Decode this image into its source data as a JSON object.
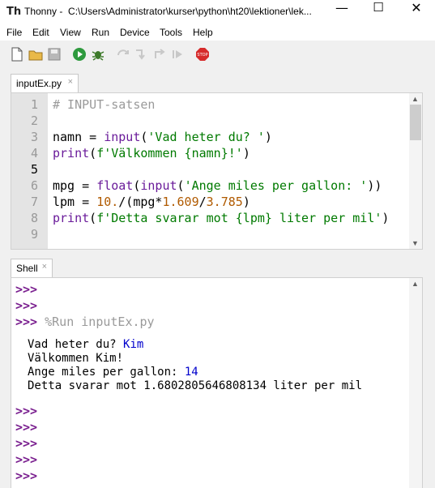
{
  "window": {
    "app_name": "Thonny",
    "path": "C:\\Users\\Administrator\\kurser\\python\\ht20\\lektioner\\lek...",
    "minimize": "—",
    "maximize": "☐",
    "close": "✕"
  },
  "menu": [
    "File",
    "Edit",
    "View",
    "Run",
    "Device",
    "Tools",
    "Help"
  ],
  "editor": {
    "tab_label": "inputEx.py",
    "tab_close": "×",
    "line_numbers": [
      "1",
      "2",
      "3",
      "4",
      "5",
      "6",
      "7",
      "8",
      "9"
    ],
    "current_line": 5,
    "lines": [
      "# INPUT-satsen",
      "",
      "namn = input('Vad heter du? ')",
      "print(f'Välkommen {namn}!')",
      "",
      "mpg = float(input('Ange miles per gallon: '))",
      "lpm = 10./(mpg*1.609/3.785)",
      "print(f'Detta svarar mot {lpm} liter per mil')",
      ""
    ]
  },
  "shell": {
    "tab_label": "Shell",
    "tab_close": "×",
    "prompt": ">>>",
    "run_command": "%Run inputEx.py",
    "output": [
      {
        "text": "Vad heter du? ",
        "input": "Kim"
      },
      {
        "text": "Välkommen Kim!",
        "input": ""
      },
      {
        "text": "Ange miles per gallon: ",
        "input": "14"
      },
      {
        "text": "Detta svarar mot 1.6802805646808134 liter per mil",
        "input": ""
      }
    ]
  },
  "colors": {
    "keyword_call": "#6a1b9a",
    "string": "#007a00",
    "number": "#b05a00",
    "comment": "#9a9a9a",
    "prompt": "#7a1f8f",
    "user_input": "#0000cc"
  }
}
